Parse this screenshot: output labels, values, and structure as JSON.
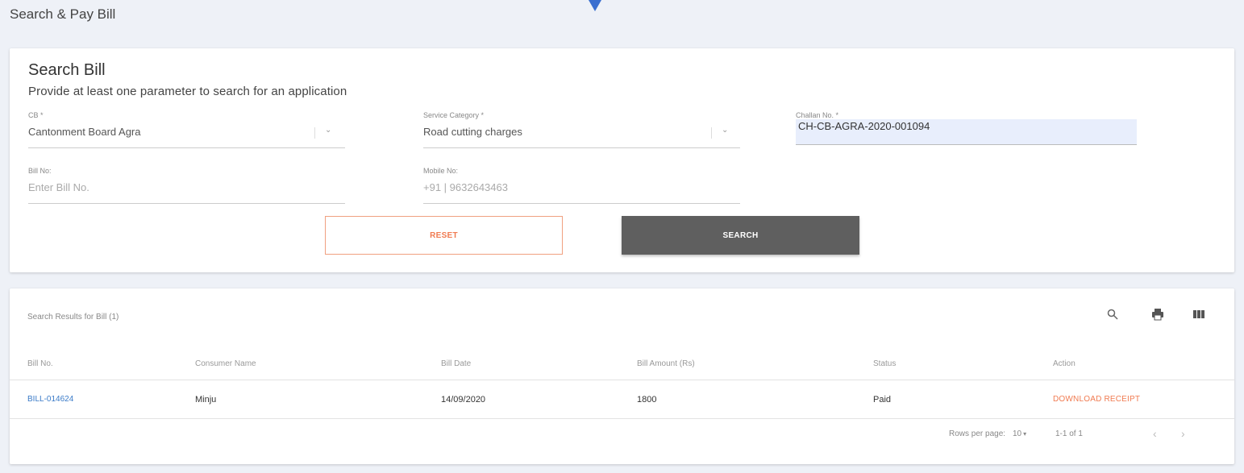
{
  "page": {
    "title": "Search & Pay Bill"
  },
  "search": {
    "title": "Search Bill",
    "subtitle": "Provide at least one parameter to search for an application",
    "cb": {
      "label": "CB *",
      "value": "Cantonment Board Agra"
    },
    "service_category": {
      "label": "Service Category *",
      "value": "Road cutting charges"
    },
    "challan": {
      "label": "Challan No. *",
      "value": "CH-CB-AGRA-2020-001094"
    },
    "bill_no": {
      "label": "Bill No:",
      "placeholder": "Enter Bill No."
    },
    "mobile": {
      "label": "Mobile No:",
      "prefix": "+91 |",
      "value": "9632643463"
    },
    "reset_label": "RESET",
    "search_label": "SEARCH"
  },
  "results": {
    "title": "Search Results for Bill (1)",
    "icons": [
      "search-icon",
      "print-icon",
      "view-columns-icon"
    ],
    "columns": [
      "Bill No.",
      "Consumer Name",
      "Bill Date",
      "Bill Amount (Rs)",
      "Status",
      "Action"
    ],
    "rows": [
      {
        "bill_no": "BILL-014624",
        "consumer": "Minju",
        "date": "14/09/2020",
        "amount": "1800",
        "status": "Paid",
        "action": "DOWNLOAD RECEIPT"
      }
    ],
    "pagination": {
      "rows_label": "Rows per page:",
      "rows_value": "10",
      "range": "1-1 of 1"
    }
  },
  "colors": {
    "accent": "#f07a50",
    "link": "#3a7bc8",
    "search_button": "#5f5f5f",
    "arrow": "#3a6fd0"
  }
}
